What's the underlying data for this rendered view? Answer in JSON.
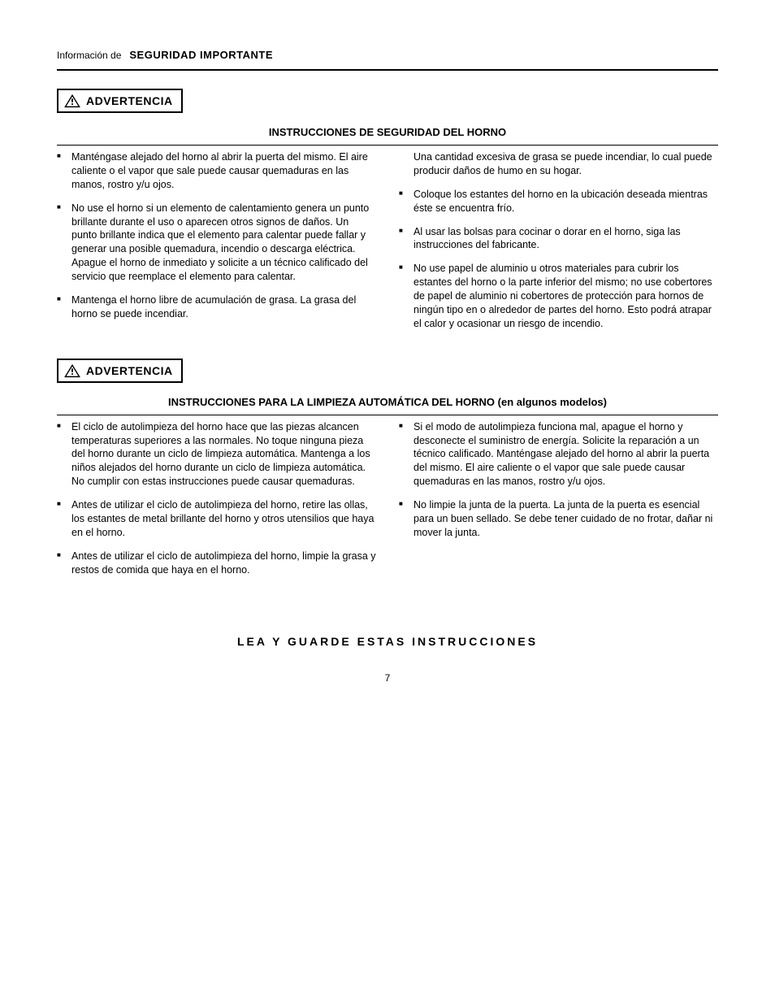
{
  "header": {
    "prefix": "Información de",
    "title": "SEGURIDAD IMPORTANTE"
  },
  "warn1": {
    "label": "ADVERTENCIA",
    "section_title": "INSTRUCCIONES DE SEGURIDAD DEL HORNO",
    "left": [
      "Manténgase alejado del horno al abrir la puerta del mismo. El aire caliente o el vapor que sale puede causar quemaduras en las manos, rostro y/u ojos.",
      "No use el horno si un elemento de calentamiento genera un punto brillante durante el uso o aparecen otros signos de daños. Un punto brillante indica que el elemento para calentar puede fallar y generar una posible quemadura, incendio o descarga eléctrica. Apague el horno de inmediato y solicite a un técnico calificado del servicio que reemplace el elemento para calentar.",
      "Mantenga el horno libre de acumulación de grasa. La grasa del horno se puede incendiar."
    ],
    "right_cont": "Una cantidad excesiva de grasa se puede incendiar, lo cual puede producir daños de humo en su hogar.",
    "right": [
      "Coloque los estantes del horno en la ubicación deseada mientras éste se encuentra frío.",
      "Al usar las bolsas para cocinar o dorar en el horno, siga las instrucciones del fabricante.",
      "No use papel de aluminio u otros materiales para cubrir los estantes del horno o la parte inferior del mismo; no use cobertores de papel de aluminio ni cobertores de protección para hornos de ningún tipo en o alrededor de partes del horno. Esto podrá atrapar el calor y ocasionar un riesgo de incendio."
    ]
  },
  "warn2": {
    "label": "ADVERTENCIA",
    "section_title": "INSTRUCCIONES PARA LA LIMPIEZA AUTOMÁTICA DEL HORNO (en algunos modelos)",
    "left": [
      "El ciclo de autolimpieza del horno hace que las piezas alcancen temperaturas superiores a las normales. No toque ninguna pieza del horno durante un ciclo de limpieza automática. Mantenga a los niños alejados del horno durante un ciclo de limpieza automática. No cumplir con estas instrucciones puede causar quemaduras."
    ],
    "left2": [
      "Antes de utilizar el ciclo de autolimpieza del horno, retire las ollas, los estantes de metal brillante del horno y otros utensilios que haya en el horno.",
      "Antes de utilizar el ciclo de autolimpieza del horno, limpie la grasa y restos de comida que haya en el horno."
    ],
    "right": [
      "Si el modo de autolimpieza funciona mal, apague el horno y desconecte el suministro de energía. Solicite la reparación a un técnico calificado. Manténgase alejado del horno al abrir la puerta del mismo. El aire caliente o el vapor que sale puede causar quemaduras en las manos, rostro y/u ojos.",
      "No limpie la junta de la puerta. La junta de la puerta es esencial para un buen sellado. Se debe tener cuidado de no frotar, dañar ni mover la junta."
    ]
  },
  "footer": {
    "line": "LEA Y GUARDE ESTAS INSTRUCCIONES",
    "page": "7"
  }
}
